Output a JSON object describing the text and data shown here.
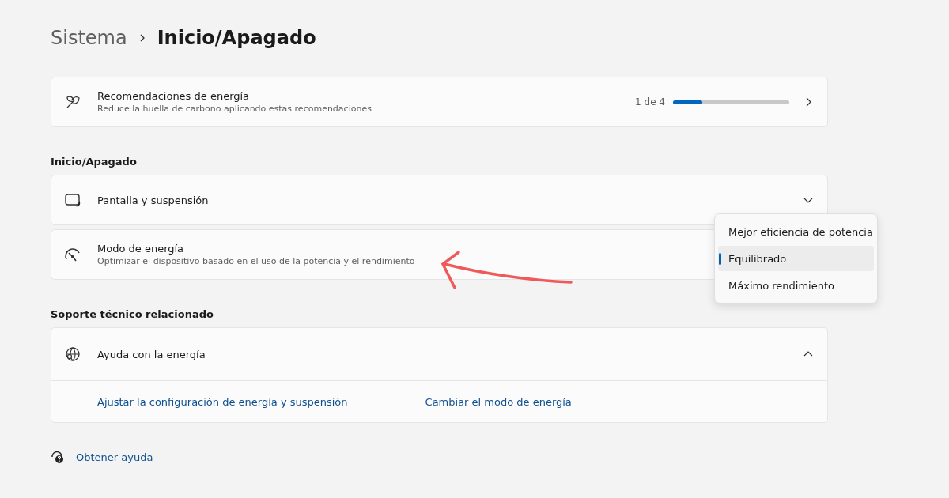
{
  "breadcrumb": {
    "parent": "Sistema",
    "current": "Inicio/Apagado"
  },
  "recommendations": {
    "title": "Recomendaciones de energía",
    "subtitle": "Reduce la huella de carbono aplicando estas recomendaciones",
    "count": "1 de 4",
    "level": 0.25
  },
  "power_section": {
    "heading": "Inicio/Apagado",
    "screen_sleep": {
      "title": "Pantalla y suspensión",
      "expanded": false
    },
    "power_mode": {
      "title": "Modo de energía",
      "subtitle": "Optimizar el dispositivo basado en el uso de la potencia y el rendimiento",
      "options": [
        {
          "label": "Mejor eficiencia de potencia",
          "selected": false
        },
        {
          "label": "Equilibrado",
          "selected": true
        },
        {
          "label": "Máximo rendimiento",
          "selected": false
        }
      ]
    }
  },
  "support_section": {
    "heading": "Soporte técnico relacionado",
    "help": {
      "title": "Ayuda con la energía",
      "expanded": true,
      "links": [
        "Ajustar la configuración de energía y suspensión",
        "Cambiar el modo de energía"
      ]
    }
  },
  "get_help": "Obtener ayuda"
}
